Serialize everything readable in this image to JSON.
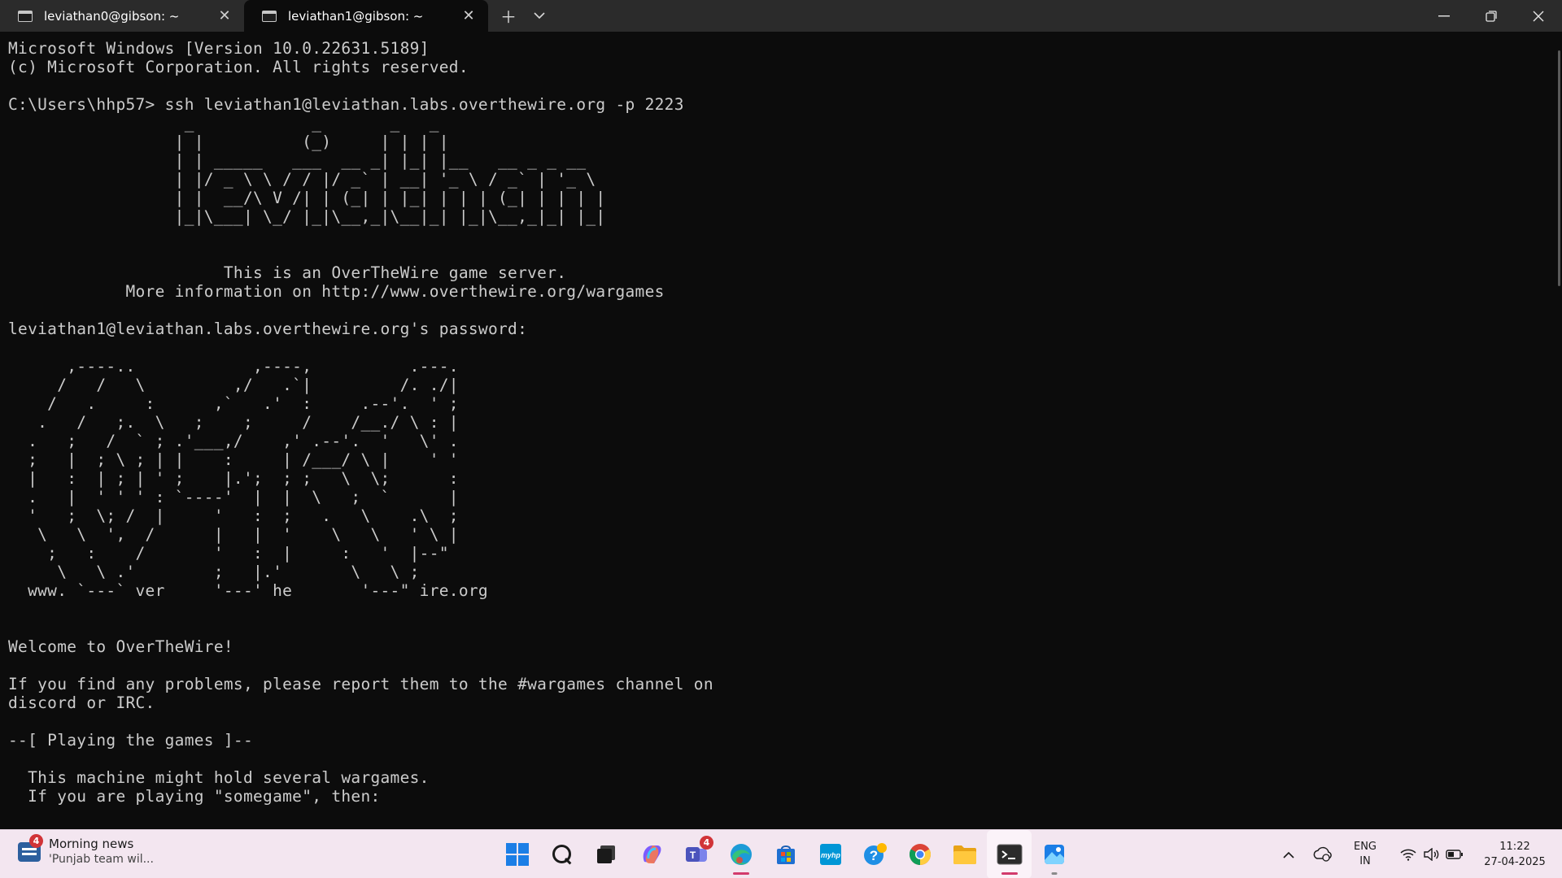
{
  "tabs": [
    {
      "label": "leviathan0@gibson: ~",
      "active": false
    },
    {
      "label": "leviathan1@gibson: ~",
      "active": true
    }
  ],
  "titlebar": {
    "new_tab_icon": "plus-icon",
    "dropdown_icon": "chevron-down-icon",
    "minimize_icon": "minimize-icon",
    "maximize_icon": "restore-icon",
    "close_icon": "close-icon"
  },
  "terminal": {
    "output": "Microsoft Windows [Version 10.0.22631.5189]\n(c) Microsoft Corporation. All rights reserved.\n\nC:\\Users\\hhp57> ssh leviathan1@leviathan.labs.overthewire.org -p 2223\n                  _            _       _   _\n                 | |          (_)     | | | |\n                 | | _____   ___  __ _| |_| |__   __ _ _ __\n                 | |/ _ \\ \\ / / |/ _` | __| '_ \\ / _` | '_ \\\n                 | |  __/\\ V /| | (_| | |_| | | | (_| | | | |\n                 |_|\\___| \\_/ |_|\\__,_|\\__|_| |_|\\__,_|_| |_|\n\n\n                      This is an OverTheWire game server.\n            More information on http://www.overthewire.org/wargames\n\nleviathan1@leviathan.labs.overthewire.org's password:\n\n      ,----..            ,----,          .---.\n     /   /   \\         ,/   .`|         /. ./|\n    /   .     :      ,`   .'  :     .--'.  ' ;\n   .   /   ;.  \\   ;    ;     /    /__./ \\ : |\n  .   ;   /  ` ; .'___,/    ,' .--'.  '   \\' .\n  ;   |  ; \\ ; | |    :     | /___/ \\ |    ' '\n  |   :  | ; | ' ;    |.';  ; ;   \\  \\;      :\n  .   |  ' ' ' : `----'  |  |  \\   ;  `      |\n  '   ;  \\; /  |     '   :  ;   .   \\    .\\  ;\n   \\   \\  ',  /      |   |  '    \\   \\   ' \\ |\n    ;   :    /       '   :  |     :   '  |--\"\n     \\   \\ .'        ;   |.'       \\   \\ ;\n  www. `---` ver     '---' he       '---\" ire.org\n\n\nWelcome to OverTheWire!\n\nIf you find any problems, please report them to the #wargames channel on\ndiscord or IRC.\n\n--[ Playing the games ]--\n\n  This machine might hold several wargames.\n  If you are playing \"somegame\", then:"
  },
  "taskbar": {
    "news": {
      "title": "Morning news",
      "subtitle": "'Punjab team wil...",
      "badge": "4",
      "icon": "news-icon"
    },
    "apps": [
      {
        "name": "start",
        "icon": "windows-start-icon"
      },
      {
        "name": "search",
        "icon": "search-icon"
      },
      {
        "name": "task-view",
        "icon": "task-view-icon"
      },
      {
        "name": "copilot",
        "icon": "copilot-icon"
      },
      {
        "name": "teams",
        "icon": "teams-icon",
        "badge": "4"
      },
      {
        "name": "edge",
        "icon": "edge-icon"
      },
      {
        "name": "store",
        "icon": "store-icon"
      },
      {
        "name": "myhp",
        "icon": "myhp-icon"
      },
      {
        "name": "get-help",
        "icon": "help-icon"
      },
      {
        "name": "chrome",
        "icon": "chrome-icon"
      },
      {
        "name": "file-explorer",
        "icon": "folder-icon"
      },
      {
        "name": "terminal",
        "icon": "terminal-icon"
      },
      {
        "name": "photos",
        "icon": "photos-icon"
      }
    ],
    "tray": {
      "chevron": "^",
      "lang_line1": "ENG",
      "lang_line2": "IN",
      "time": "11:22",
      "date": "27-04-2025"
    }
  }
}
